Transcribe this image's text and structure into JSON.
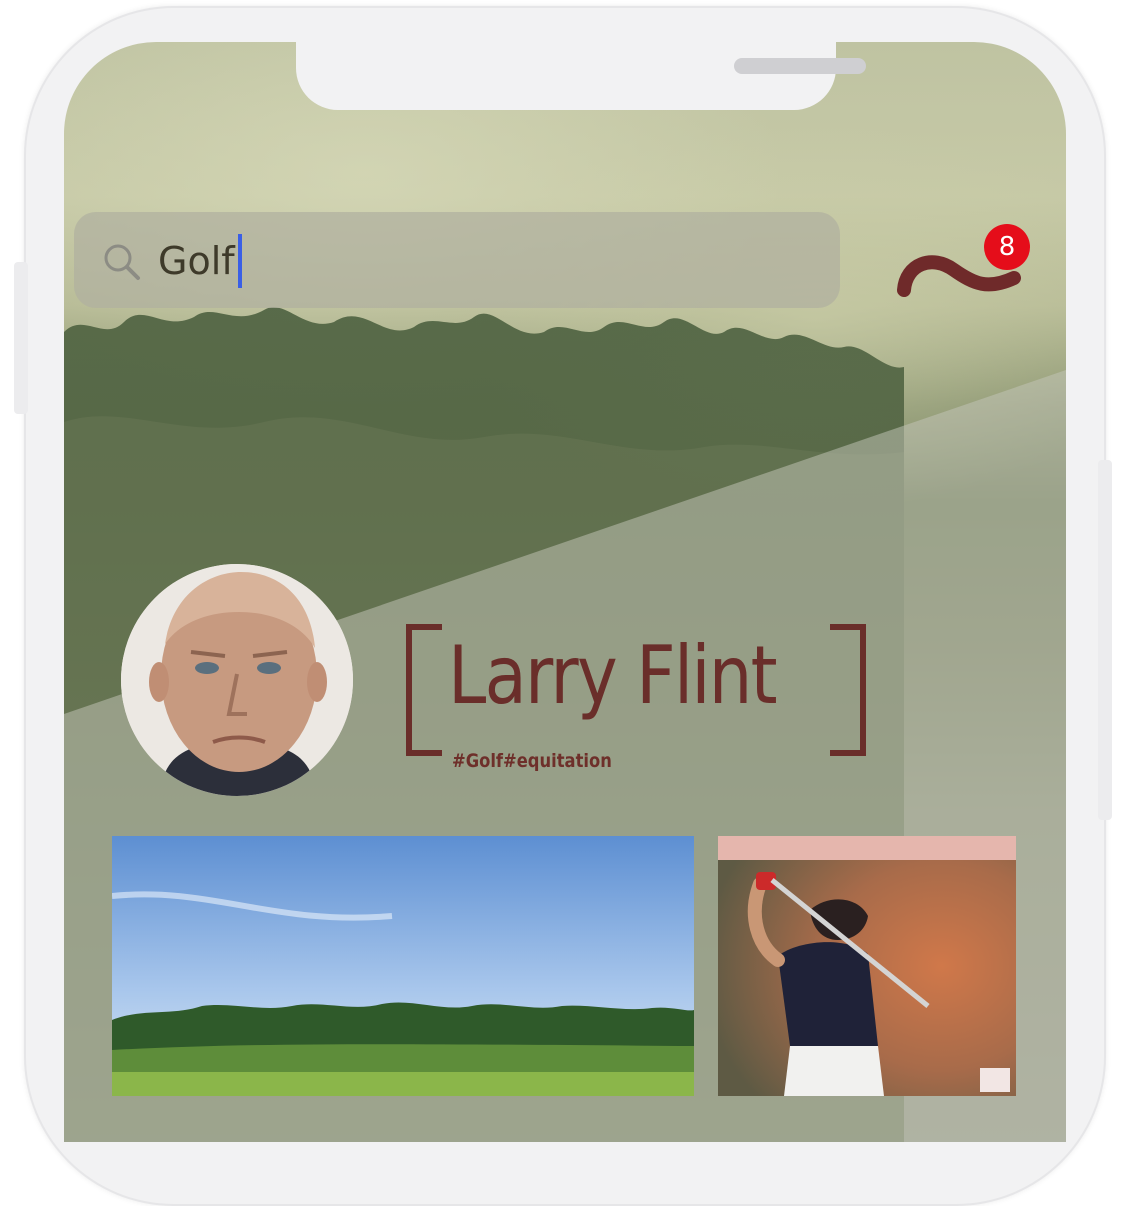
{
  "search": {
    "value": "Golf",
    "icon": "search-icon"
  },
  "notifications": {
    "count": "8",
    "icon": "squiggle-logo-icon",
    "badge_color": "#e50d1a"
  },
  "profile": {
    "name": "Larry Flint",
    "tags": "#Golf#equitation",
    "accent_color": "#6a2e2a"
  },
  "gallery": [
    {
      "kind": "golf-course-photo"
    },
    {
      "kind": "golfer-swing-photo"
    }
  ]
}
